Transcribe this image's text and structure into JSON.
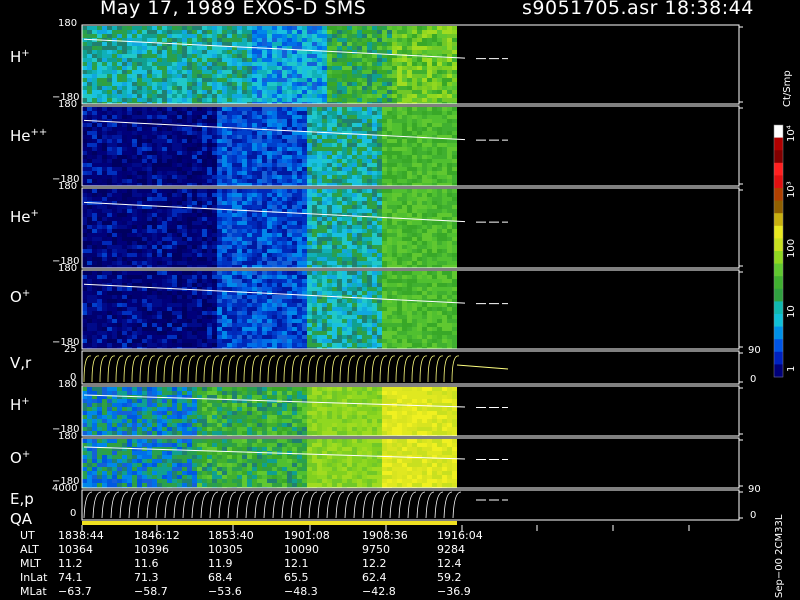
{
  "header": {
    "title": "May 17, 1989   EXOS-D SMS",
    "file": "s9051705.asr  18:38:44"
  },
  "colorbar": {
    "unit": "Ct/Smp",
    "labels": [
      "1",
      "10",
      "100",
      "10³",
      "10⁴"
    ],
    "colors": [
      "#00007a",
      "#0022c0",
      "#0055e6",
      "#0090e8",
      "#10c0d8",
      "#10b8b0",
      "#30a040",
      "#40b030",
      "#60c830",
      "#90d820",
      "#c8e020",
      "#e8e820",
      "#c8b010",
      "#906000",
      "#b04000",
      "#e01010",
      "#ff2020",
      "#800000",
      "#b00000",
      "#ffffff"
    ]
  },
  "panels": [
    {
      "name": "H",
      "sup": "+",
      "ytop": "180",
      "ybot": "−180"
    },
    {
      "name": "He",
      "sup": "++",
      "ytop": "180",
      "ybot": "−180"
    },
    {
      "name": "He",
      "sup": "+",
      "ytop": "180",
      "ybot": "−180"
    },
    {
      "name": "O",
      "sup": "+",
      "ytop": "180",
      "ybot": "−180"
    },
    {
      "name": "V,r",
      "sup": "",
      "ytop": "25",
      "ybot": "0",
      "rtop": "90",
      "rbot": "0"
    },
    {
      "name": "H",
      "sup": "+",
      "ytop": "180",
      "ybot": "−180"
    },
    {
      "name": "O",
      "sup": "+",
      "ytop": "180",
      "ybot": "−180"
    },
    {
      "name": "E,p",
      "sup": "",
      "ytop": "4000",
      "ybot": "0",
      "rtop": "90",
      "rbot": "0"
    }
  ],
  "qa_label": "QA",
  "side_text": "Sep−00  2CM33L",
  "ephemeris": {
    "rows": [
      {
        "label": "UT",
        "values": [
          "1838:44",
          "1846:12",
          "1853:40",
          "1901:08",
          "1908:36",
          "1916:04"
        ]
      },
      {
        "label": "ALT",
        "values": [
          "10364",
          "10396",
          "10305",
          "10090",
          "9750",
          "9284"
        ]
      },
      {
        "label": "MLT",
        "values": [
          "11.2",
          "11.6",
          "11.9",
          "12.1",
          "12.2",
          "12.4"
        ]
      },
      {
        "label": "InLat",
        "values": [
          "74.1",
          "71.3",
          "68.4",
          "65.5",
          "62.4",
          "59.2"
        ]
      },
      {
        "label": "MLat",
        "values": [
          "−63.7",
          "−58.7",
          "−53.6",
          "−48.3",
          "−42.8",
          "−36.9"
        ]
      }
    ]
  },
  "chart_data": {
    "type": "heatmap",
    "title": "May 17, 1989   EXOS-D SMS",
    "x": [
      "1838:44",
      "1846:12",
      "1853:40",
      "1901:08",
      "1908:36",
      "1916:04"
    ],
    "pitch_angle_range": [
      -180,
      180
    ],
    "velocity_range": [
      0,
      25
    ],
    "energy_range": [
      0,
      4000
    ],
    "colorbar_range": [
      1,
      10000
    ],
    "log_scale": true
  }
}
